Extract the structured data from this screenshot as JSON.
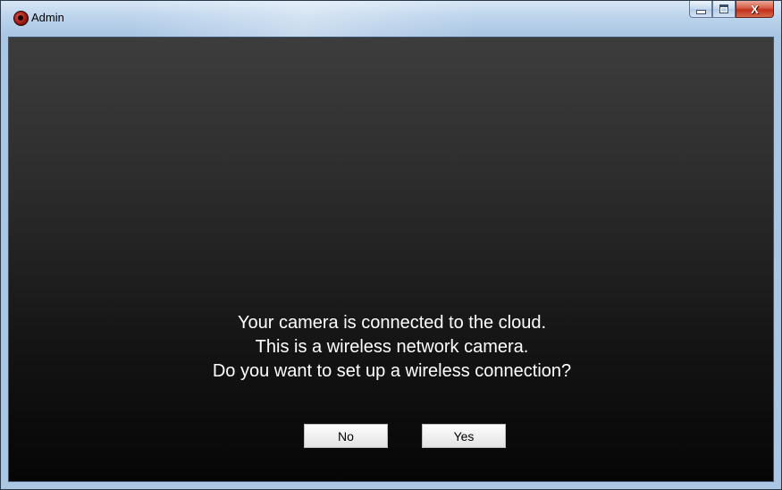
{
  "window": {
    "title": "Admin",
    "icon": "camera-app-icon",
    "controls": {
      "minimize": "minimize-icon",
      "maximize": "maximize-icon",
      "close": "close-icon",
      "close_glyph": "X"
    }
  },
  "dialog": {
    "message_lines": [
      "Your camera is connected to the cloud.",
      "This is a wireless network camera.",
      "Do you want to set up a wireless connection?"
    ],
    "no_label": "No",
    "yes_label": "Yes"
  },
  "colors": {
    "titlebar": "#bcd4ec",
    "client_top": "#3d3d3d",
    "client_bottom": "#060606",
    "text": "#ffffff",
    "close_button": "#c0311a"
  }
}
